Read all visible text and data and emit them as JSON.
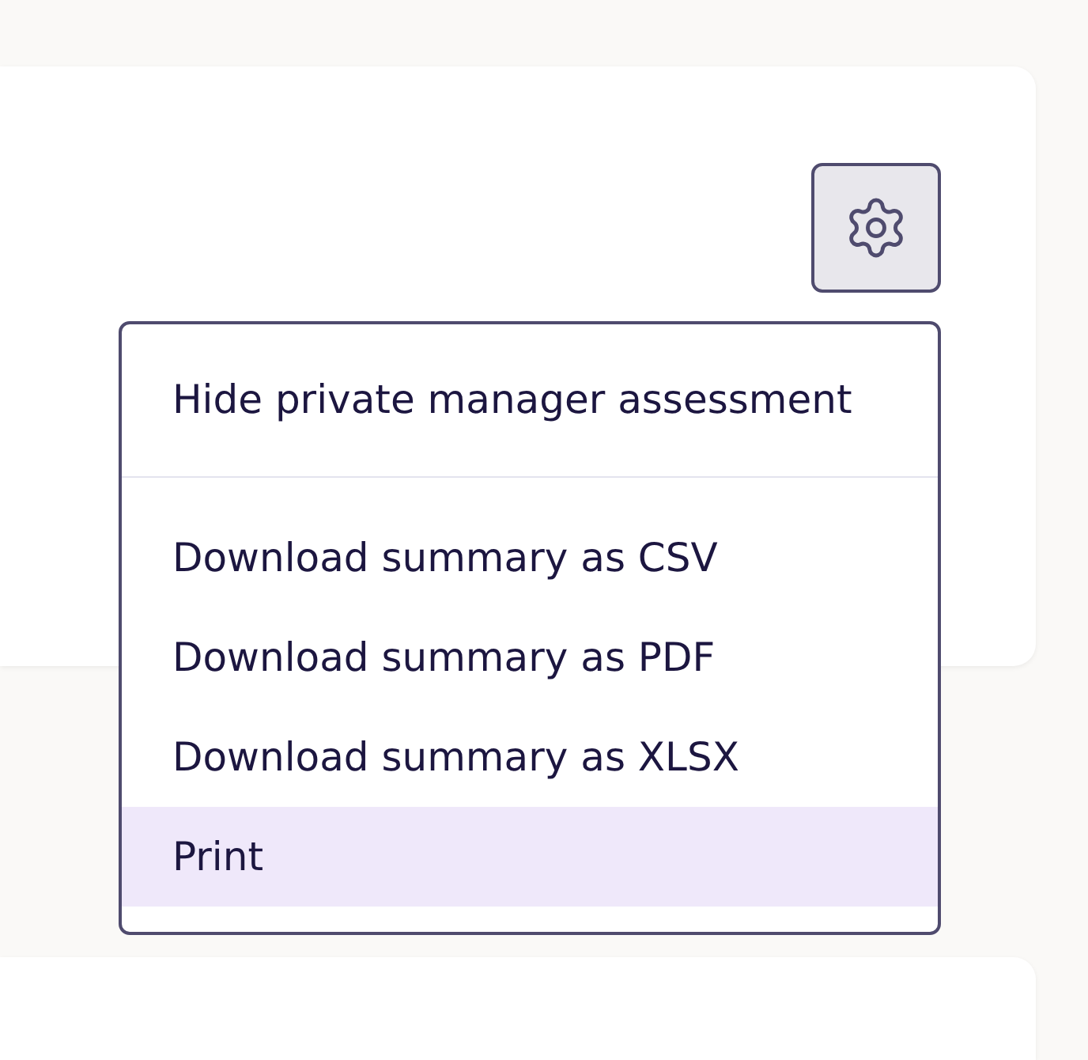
{
  "settings_button": {
    "expanded": true
  },
  "menu": {
    "sections": [
      {
        "items": [
          {
            "label": "Hide private manager assessment",
            "highlighted": false
          }
        ]
      },
      {
        "items": [
          {
            "label": "Download summary as CSV",
            "highlighted": false
          },
          {
            "label": "Download summary as PDF",
            "highlighted": false
          },
          {
            "label": "Download summary as XLSX",
            "highlighted": false
          },
          {
            "label": "Print",
            "highlighted": true
          }
        ]
      }
    ]
  }
}
